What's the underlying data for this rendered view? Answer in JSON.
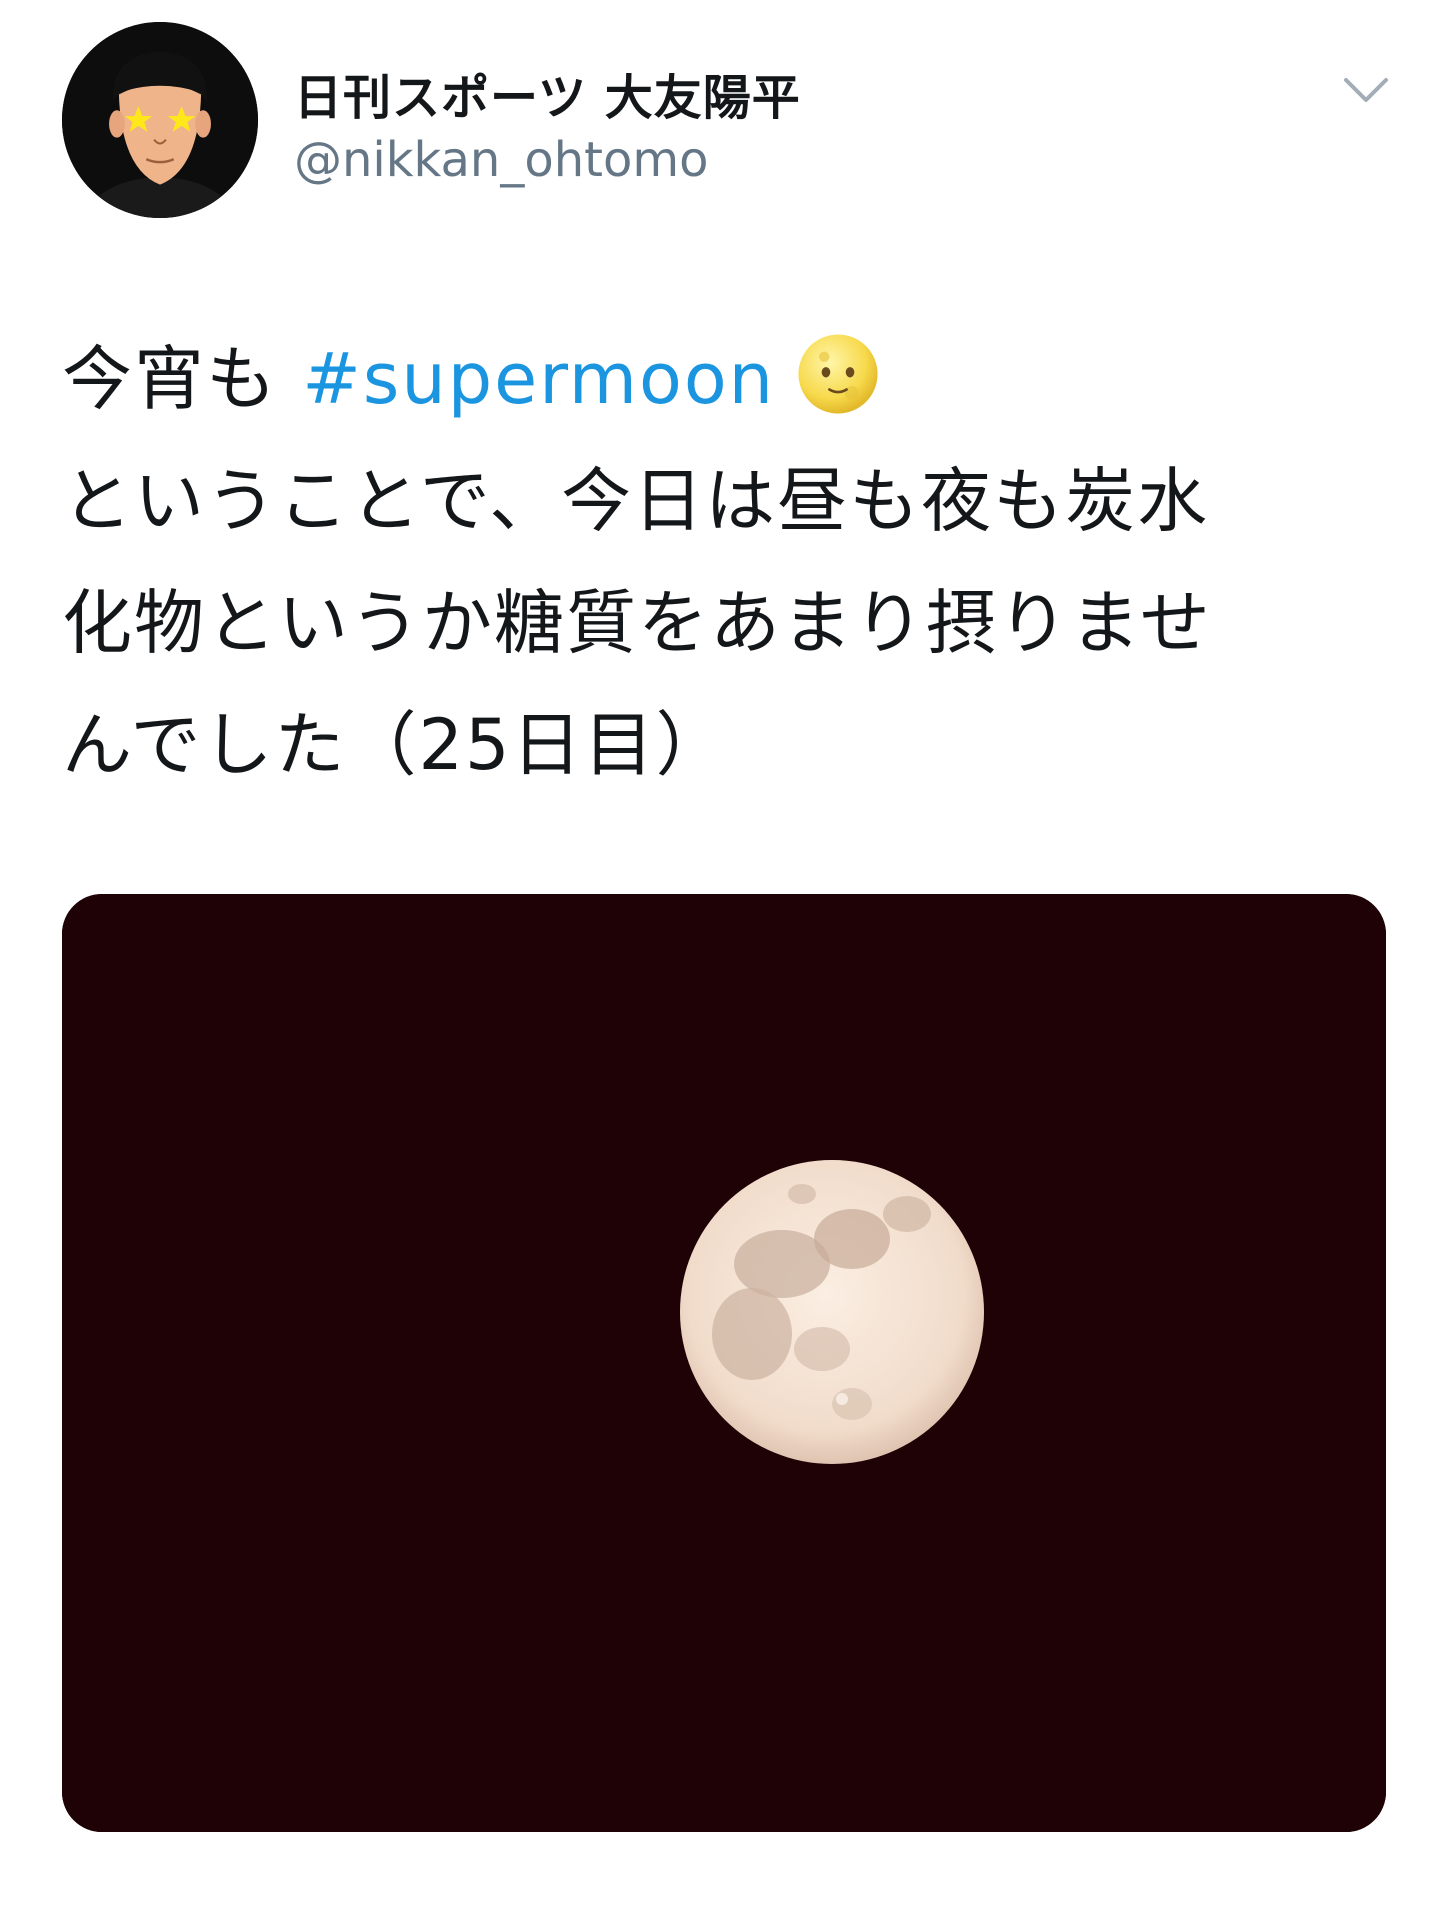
{
  "tweet": {
    "author": {
      "display_name": "日刊スポーツ 大友陽平",
      "handle": "@nikkan_ohtomo",
      "avatar_icon": "cartoon-avatar-icon"
    },
    "menu_icon": "chevron-down-icon",
    "text": {
      "line1_prefix": "今宵も ",
      "hashtag": "#supermoon",
      "emoji": "full-moon-face-icon",
      "line2": "ということで、今日は昼も夜も炭水",
      "line3": "化物というか糖質をあまり摂りませ",
      "line4": "んでした（25日目）"
    },
    "media": {
      "type": "photo",
      "subject": "full-moon-photo"
    }
  },
  "colors": {
    "text": "#14171a",
    "secondary": "#657786",
    "hashtag": "#1b95e0",
    "media_background": "#1f0205",
    "moon": "#f3e0cf"
  }
}
